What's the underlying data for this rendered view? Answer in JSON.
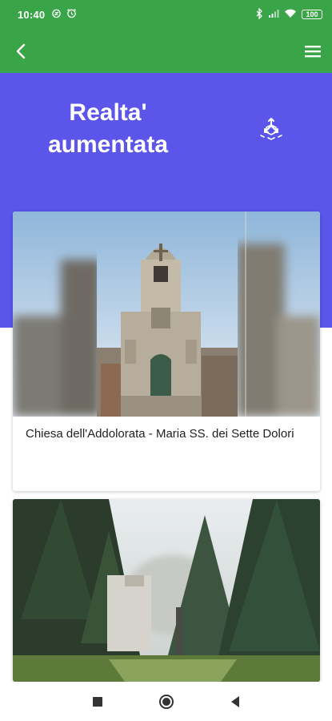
{
  "status_bar": {
    "time": "10:40",
    "battery": "100",
    "icons": [
      "alarm-snooze-icon",
      "alarm-clock-icon",
      "bluetooth-icon",
      "signal-icon",
      "wifi-icon",
      "battery-icon"
    ]
  },
  "app_bar": {
    "back_icon": "chevron-left-icon",
    "menu_icon": "hamburger-menu-icon",
    "color": "#3aa548"
  },
  "hero": {
    "title_line1": "Realta'",
    "title_line2": "aumentata",
    "ar_icon": "ar-cube-icon",
    "color": "#5b55ea"
  },
  "cards": [
    {
      "title": "Chiesa dell'Addolorata - Maria SS. dei Sette Dolori",
      "image": "church-facade-photo"
    },
    {
      "title": "",
      "image": "forest-path-photo"
    }
  ],
  "nav_bar": {
    "icons": [
      "recents-square-icon",
      "home-circle-icon",
      "back-triangle-icon"
    ]
  }
}
